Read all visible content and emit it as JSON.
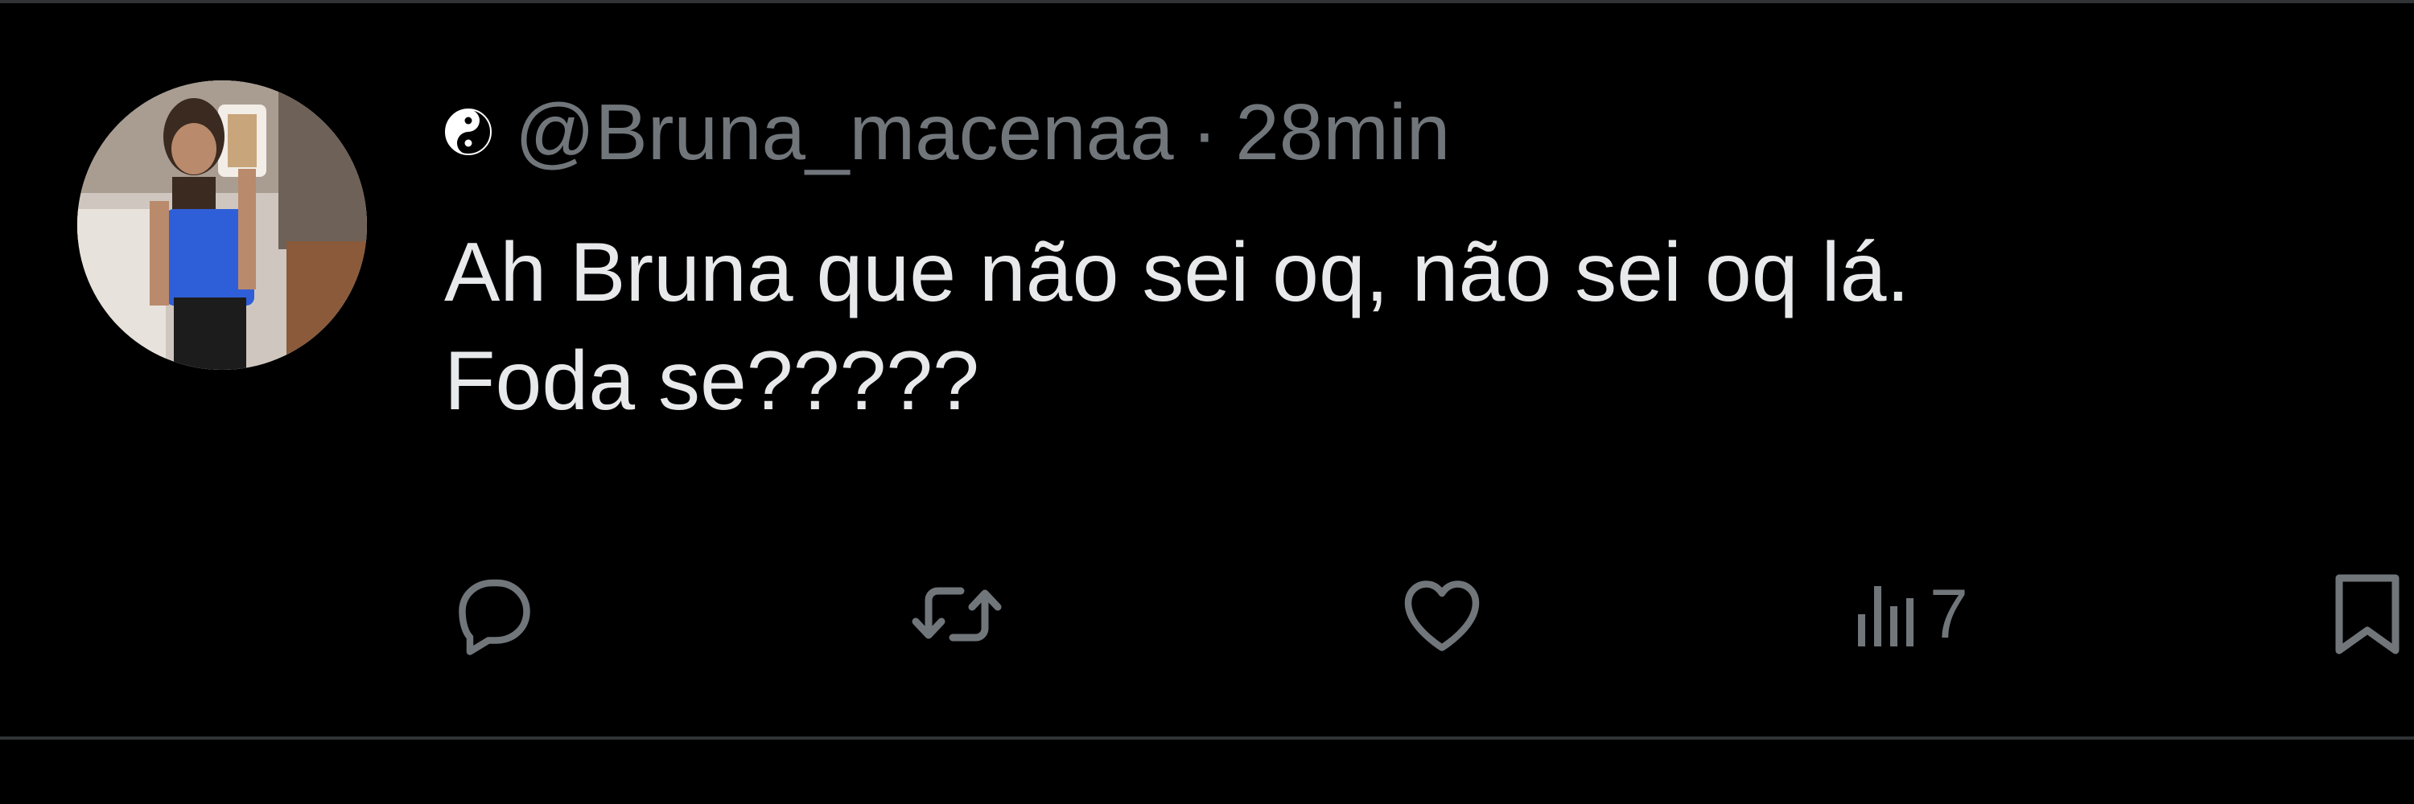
{
  "tweet": {
    "handle": "@Bruna_macenaa",
    "separator": "·",
    "timestamp": "28min",
    "text_lines": [
      "Ah Bruna que não sei oq, não sei oq lá.",
      "Foda se?????"
    ],
    "badge_icon": "yin-yang-icon",
    "actions": {
      "reply_icon": "reply-icon",
      "repost_icon": "repost-icon",
      "like_icon": "heart-icon",
      "views_icon": "views-chart-icon",
      "views_count": "7",
      "bookmark_icon": "bookmark-icon"
    }
  },
  "colors": {
    "background": "#000000",
    "primary_text": "#e7e9ea",
    "secondary_text": "#71767b",
    "divider": "#2f3336"
  }
}
